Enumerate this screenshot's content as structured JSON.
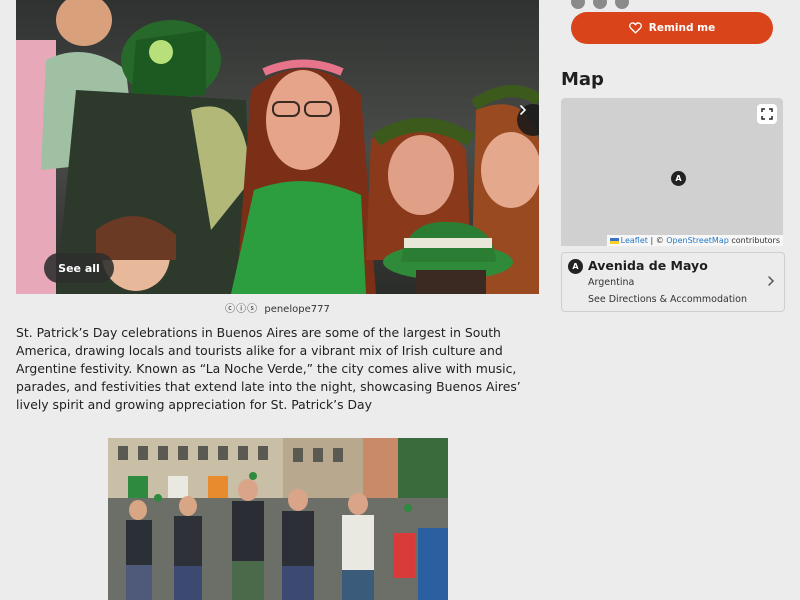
{
  "hero": {
    "see_all_label": "See all",
    "next_icon": "chevron-right-icon",
    "credit_license": "ⓒⓘⓢ",
    "credit_author": "penelope777"
  },
  "article": {
    "paragraph": "St. Patrick’s Day celebrations in Buenos Aires are some of the largest in South America, drawing locals and tourists alike for a vibrant mix of Irish culture and Argentine festivity. Known as “La Noche Verde,” the city comes alive with music, parades, and festivities that extend late into the night, showcasing Buenos Aires’ lively spirit and growing appreciation for St. Patrick’s Day"
  },
  "sidebar": {
    "remind_label": "Remind me",
    "remind_icon": "heart-icon",
    "accent_color": "#d9441b",
    "map": {
      "heading": "Map",
      "marker_label": "A",
      "attribution_leaflet": "Leaflet",
      "attribution_sep": " | © ",
      "attribution_osm": "OpenStreetMap",
      "attribution_suffix": " contributors"
    },
    "location": {
      "marker_label": "A",
      "name": "Avenida de Mayo",
      "country": "Argentina",
      "directions": "See Directions & Accommodation"
    }
  }
}
